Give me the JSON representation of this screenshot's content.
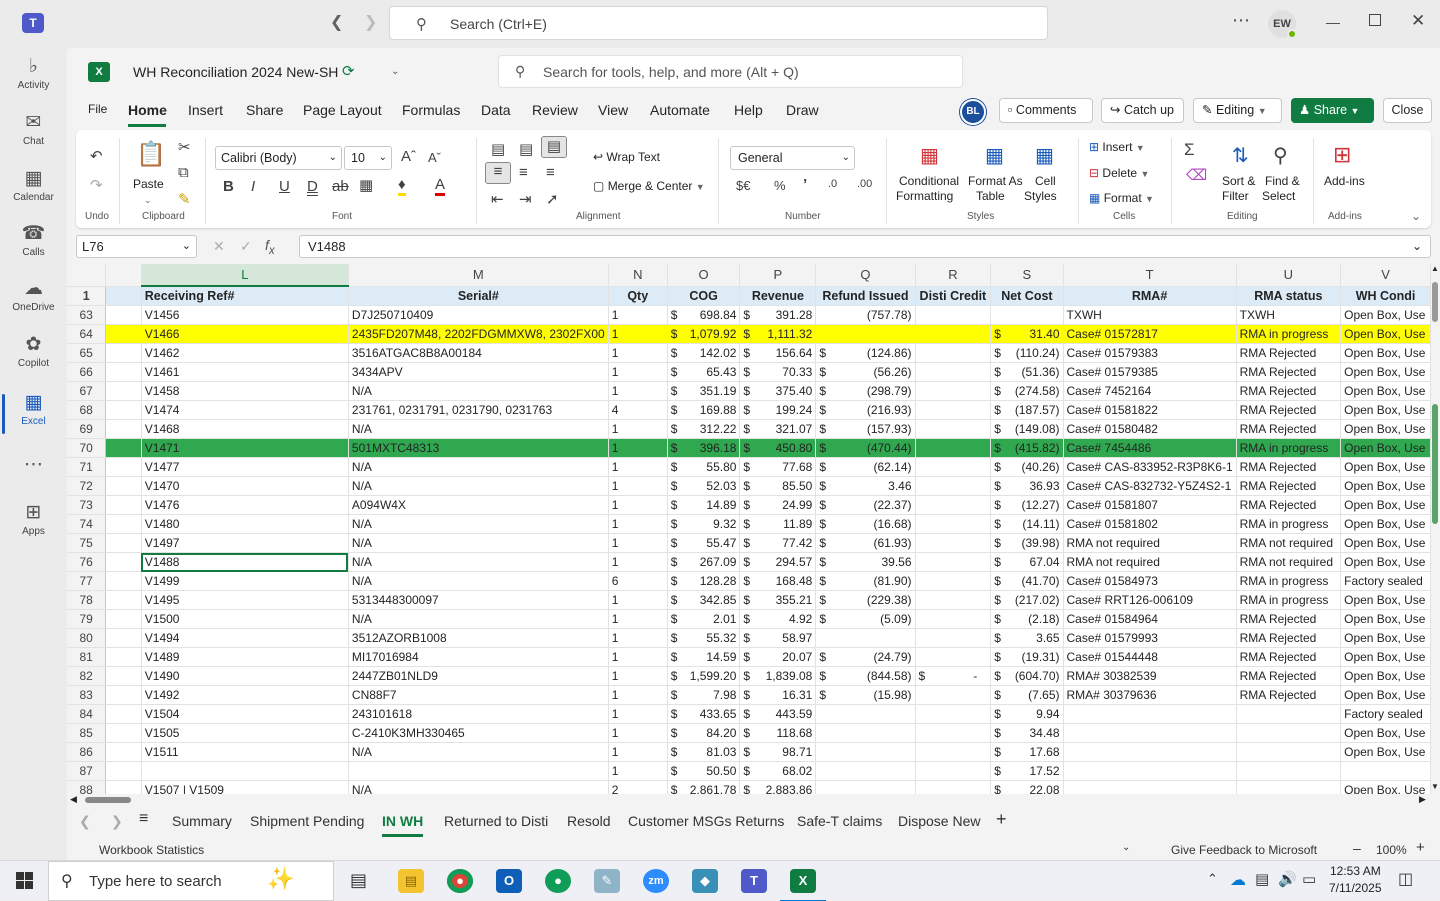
{
  "teams": {
    "search_placeholder": "Search (Ctrl+E)",
    "user_initials": "EW",
    "rail": [
      {
        "label": "Activity",
        "icon": "bell-icon"
      },
      {
        "label": "Chat",
        "icon": "chat-icon"
      },
      {
        "label": "Calendar",
        "icon": "calendar-icon"
      },
      {
        "label": "Calls",
        "icon": "phone-icon"
      },
      {
        "label": "OneDrive",
        "icon": "cloud-icon"
      },
      {
        "label": "Copilot",
        "icon": "copilot-icon"
      },
      {
        "label": "Excel",
        "icon": "excel-icon"
      },
      {
        "label": "Apps",
        "icon": "apps-icon"
      }
    ]
  },
  "excel": {
    "workbook_title": "WH Reconciliation 2024 New-SH",
    "tools_search": "Search for tools, help, and more (Alt + Q)",
    "menu": [
      "File",
      "Home",
      "Insert",
      "Share",
      "Page Layout",
      "Formulas",
      "Data",
      "Review",
      "View",
      "Automate",
      "Help",
      "Draw"
    ],
    "avatar": "BL",
    "comments": "Comments",
    "catch_up": "Catch up",
    "editing": "Editing",
    "share": "Share",
    "close": "Close",
    "ribbon": {
      "undo_group": "Undo",
      "paste": "Paste",
      "clipboard": "Clipboard",
      "font_name": "Calibri (Body)",
      "font_size": "10",
      "font": "Font",
      "wrap_text": "Wrap Text",
      "merge_center": "Merge & Center",
      "alignment": "Alignment",
      "number_format": "General",
      "number": "Number",
      "cond_format_1": "Conditional",
      "cond_format_2": "Formatting",
      "format_table_1": "Format As",
      "format_table_2": "Table",
      "cell_styles_1": "Cell",
      "cell_styles_2": "Styles",
      "styles": "Styles",
      "insert": "Insert",
      "delete": "Delete",
      "format": "Format",
      "cells": "Cells",
      "sort_1": "Sort &",
      "sort_2": "Filter",
      "find_1": "Find &",
      "find_2": "Select",
      "editing_group": "Editing",
      "addins": "Add-ins",
      "addins_group": "Add-ins"
    },
    "name_box": "L76",
    "formula": "V1488",
    "columns": [
      "L",
      "M",
      "N",
      "O",
      "P",
      "Q",
      "R",
      "S",
      "T",
      "U",
      "V"
    ],
    "headers": [
      "Receiving Ref#",
      "Serial#",
      "Qty",
      "COG",
      "Revenue",
      "Refund Issued",
      "Disti Credit",
      "Net Cost",
      "RMA#",
      "RMA status",
      "WH Condi"
    ],
    "rows": [
      {
        "n": "63",
        "ref": "V1456",
        "serial": "D7J250710409",
        "qty": "1",
        "cog": "698.84",
        "rev": "391.28",
        "ref_iss": "(757.78)",
        "disti": "",
        "net": "",
        "rma": "TXWH",
        "status": "TXWH",
        "cond": "Open Box, Use",
        "cog_d": "$",
        "rev_d": "$",
        "ri_d": "",
        "di_d": "",
        "net_d": ""
      },
      {
        "n": "64",
        "ref": "V1466",
        "serial": "2435FD207M48, 2202FDGMMXW8, 2302FX00",
        "qty": "1",
        "cog": "1,079.92",
        "rev": "1,111.32",
        "ref_iss": "",
        "disti": "",
        "net": "31.40",
        "rma": "Case# 01572817",
        "status": "RMA in progress",
        "cond": "Open Box, Use",
        "cog_d": "$",
        "rev_d": "$",
        "ri_d": "",
        "di_d": "",
        "net_d": "$",
        "hl": "yellow"
      },
      {
        "n": "65",
        "ref": "V1462",
        "serial": "3516ATGAC8B8A00184",
        "qty": "1",
        "cog": "142.02",
        "rev": "156.64",
        "ref_iss": "(124.86)",
        "disti": "",
        "net": "(110.24)",
        "rma": "Case# 01579383",
        "status": "RMA Rejected",
        "cond": "Open Box, Use",
        "cog_d": "$",
        "rev_d": "$",
        "ri_d": "$",
        "di_d": "",
        "net_d": "$"
      },
      {
        "n": "66",
        "ref": "V1461",
        "serial": "3434APV",
        "qty": "1",
        "cog": "65.43",
        "rev": "70.33",
        "ref_iss": "(56.26)",
        "disti": "",
        "net": "(51.36)",
        "rma": "Case# 01579385",
        "status": "RMA Rejected",
        "cond": "Open Box, Use",
        "cog_d": "$",
        "rev_d": "$",
        "ri_d": "$",
        "di_d": "",
        "net_d": "$"
      },
      {
        "n": "67",
        "ref": "V1458",
        "serial": "N/A",
        "qty": "1",
        "cog": "351.19",
        "rev": "375.40",
        "ref_iss": "(298.79)",
        "disti": "",
        "net": "(274.58)",
        "rma": "Case# 7452164",
        "status": "RMA Rejected",
        "cond": "Open Box, Use",
        "cog_d": "$",
        "rev_d": "$",
        "ri_d": "$",
        "di_d": "",
        "net_d": "$"
      },
      {
        "n": "68",
        "ref": "V1474",
        "serial": "231761, 0231791, 0231790, 0231763",
        "qty": "4",
        "cog": "169.88",
        "rev": "199.24",
        "ref_iss": "(216.93)",
        "disti": "",
        "net": "(187.57)",
        "rma": "Case# 01581822",
        "status": "RMA Rejected",
        "cond": "Open Box, Use",
        "cog_d": "$",
        "rev_d": "$",
        "ri_d": "$",
        "di_d": "",
        "net_d": "$"
      },
      {
        "n": "69",
        "ref": "V1468",
        "serial": "N/A",
        "qty": "1",
        "cog": "312.22",
        "rev": "321.07",
        "ref_iss": "(157.93)",
        "disti": "",
        "net": "(149.08)",
        "rma": "Case# 01580482",
        "status": "RMA Rejected",
        "cond": "Open Box, Use",
        "cog_d": "$",
        "rev_d": "$",
        "ri_d": "$",
        "di_d": "",
        "net_d": "$"
      },
      {
        "n": "70",
        "ref": "V1471",
        "serial": "501MXTC48313",
        "qty": "1",
        "cog": "396.18",
        "rev": "450.80",
        "ref_iss": "(470.44)",
        "disti": "",
        "net": "(415.82)",
        "rma": "Case# 7454486",
        "status": "RMA in progress",
        "cond": "Open Box, Use",
        "cog_d": "$",
        "rev_d": "$",
        "ri_d": "$",
        "di_d": "",
        "net_d": "$",
        "hl": "green"
      },
      {
        "n": "71",
        "ref": "V1477",
        "serial": "N/A",
        "qty": "1",
        "cog": "55.80",
        "rev": "77.68",
        "ref_iss": "(62.14)",
        "disti": "",
        "net": "(40.26)",
        "rma": "Case# CAS-833952-R3P8K6-1",
        "status": "RMA Rejected",
        "cond": "Open Box, Use",
        "cog_d": "$",
        "rev_d": "$",
        "ri_d": "$",
        "di_d": "",
        "net_d": "$"
      },
      {
        "n": "72",
        "ref": "V1470",
        "serial": "N/A",
        "qty": "1",
        "cog": "52.03",
        "rev": "85.50",
        "ref_iss": "3.46",
        "disti": "",
        "net": "36.93",
        "rma": "Case# CAS-832732-Y5Z4S2-1",
        "status": "RMA Rejected",
        "cond": "Open Box, Use",
        "cog_d": "$",
        "rev_d": "$",
        "ri_d": "$",
        "di_d": "",
        "net_d": "$"
      },
      {
        "n": "73",
        "ref": "V1476",
        "serial": "A094W4X",
        "qty": "1",
        "cog": "14.89",
        "rev": "24.99",
        "ref_iss": "(22.37)",
        "disti": "",
        "net": "(12.27)",
        "rma": "Case# 01581807",
        "status": "RMA Rejected",
        "cond": "Open Box, Use",
        "cog_d": "$",
        "rev_d": "$",
        "ri_d": "$",
        "di_d": "",
        "net_d": "$"
      },
      {
        "n": "74",
        "ref": "V1480",
        "serial": "N/A",
        "qty": "1",
        "cog": "9.32",
        "rev": "11.89",
        "ref_iss": "(16.68)",
        "disti": "",
        "net": "(14.11)",
        "rma": "Case# 01581802",
        "status": "RMA in progress",
        "cond": "Open Box, Use",
        "cog_d": "$",
        "rev_d": "$",
        "ri_d": "$",
        "di_d": "",
        "net_d": "$"
      },
      {
        "n": "75",
        "ref": "V1497",
        "serial": "N/A",
        "qty": "1",
        "cog": "55.47",
        "rev": "77.42",
        "ref_iss": "(61.93)",
        "disti": "",
        "net": "(39.98)",
        "rma": "RMA not required",
        "status": "RMA not required",
        "cond": "Open Box, Use",
        "cog_d": "$",
        "rev_d": "$",
        "ri_d": "$",
        "di_d": "",
        "net_d": "$"
      },
      {
        "n": "76",
        "ref": "V1488",
        "serial": "N/A",
        "qty": "1",
        "cog": "267.09",
        "rev": "294.57",
        "ref_iss": "39.56",
        "disti": "",
        "net": "67.04",
        "rma": "RMA not required",
        "status": "RMA not required",
        "cond": "Open Box, Use",
        "cog_d": "$",
        "rev_d": "$",
        "ri_d": "$",
        "di_d": "",
        "net_d": "$",
        "active": true
      },
      {
        "n": "77",
        "ref": "V1499",
        "serial": "N/A",
        "qty": "6",
        "cog": "128.28",
        "rev": "168.48",
        "ref_iss": "(81.90)",
        "disti": "",
        "net": "(41.70)",
        "rma": "Case# 01584973",
        "status": "RMA in progress",
        "cond": "Factory sealed",
        "cog_d": "$",
        "rev_d": "$",
        "ri_d": "$",
        "di_d": "",
        "net_d": "$"
      },
      {
        "n": "78",
        "ref": "V1495",
        "serial": "5313448300097",
        "qty": "1",
        "cog": "342.85",
        "rev": "355.21",
        "ref_iss": "(229.38)",
        "disti": "",
        "net": "(217.02)",
        "rma": "Case# RRT126-006109",
        "status": "RMA in progress",
        "cond": "Open Box, Use",
        "cog_d": "$",
        "rev_d": "$",
        "ri_d": "$",
        "di_d": "",
        "net_d": "$"
      },
      {
        "n": "79",
        "ref": "V1500",
        "serial": "N/A",
        "qty": "1",
        "cog": "2.01",
        "rev": "4.92",
        "ref_iss": "(5.09)",
        "disti": "",
        "net": "(2.18)",
        "rma": "Case# 01584964",
        "status": "RMA Rejected",
        "cond": "Open Box, Use",
        "cog_d": "$",
        "rev_d": "$",
        "ri_d": "$",
        "di_d": "",
        "net_d": "$"
      },
      {
        "n": "80",
        "ref": "V1494",
        "serial": "3512AZORB1008",
        "qty": "1",
        "cog": "55.32",
        "rev": "58.97",
        "ref_iss": "",
        "disti": "",
        "net": "3.65",
        "rma": "Case# 01579993",
        "status": "RMA Rejected",
        "cond": "Open Box, Use",
        "cog_d": "$",
        "rev_d": "$",
        "ri_d": "",
        "di_d": "",
        "net_d": "$"
      },
      {
        "n": "81",
        "ref": "V1489",
        "serial": "MI17016984",
        "qty": "1",
        "cog": "14.59",
        "rev": "20.07",
        "ref_iss": "(24.79)",
        "disti": "",
        "net": "(19.31)",
        "rma": "Case# 01544448",
        "status": "RMA Rejected",
        "cond": "Open Box, Use",
        "cog_d": "$",
        "rev_d": "$",
        "ri_d": "$",
        "di_d": "",
        "net_d": "$"
      },
      {
        "n": "82",
        "ref": "V1490",
        "serial": "2447ZB01NLD9",
        "qty": "1",
        "cog": "1,599.20",
        "rev": "1,839.08",
        "ref_iss": "(844.58)",
        "disti": "-",
        "net": "(604.70)",
        "rma": "RMA# 30382539",
        "status": "RMA Rejected",
        "cond": "Open Box, Use",
        "cog_d": "$",
        "rev_d": "$",
        "ri_d": "$",
        "di_d": "$",
        "net_d": "$"
      },
      {
        "n": "83",
        "ref": "V1492",
        "serial": "CN88F7",
        "qty": "1",
        "cog": "7.98",
        "rev": "16.31",
        "ref_iss": "(15.98)",
        "disti": "",
        "net": "(7.65)",
        "rma": "RMA# 30379636",
        "status": "RMA Rejected",
        "cond": "Open Box, Use",
        "cog_d": "$",
        "rev_d": "$",
        "ri_d": "$",
        "di_d": "",
        "net_d": "$"
      },
      {
        "n": "84",
        "ref": "V1504",
        "serial": "243101618",
        "qty": "1",
        "cog": "433.65",
        "rev": "443.59",
        "ref_iss": "",
        "disti": "",
        "net": "9.94",
        "rma": "",
        "status": "",
        "cond": "Factory sealed",
        "cog_d": "$",
        "rev_d": "$",
        "ri_d": "",
        "di_d": "",
        "net_d": "$"
      },
      {
        "n": "85",
        "ref": "V1505",
        "serial": "C-2410K3MH330465",
        "qty": "1",
        "cog": "84.20",
        "rev": "118.68",
        "ref_iss": "",
        "disti": "",
        "net": "34.48",
        "rma": "",
        "status": "",
        "cond": "Open Box, Use",
        "cog_d": "$",
        "rev_d": "$",
        "ri_d": "",
        "di_d": "",
        "net_d": "$"
      },
      {
        "n": "86",
        "ref": "V1511",
        "serial": "N/A",
        "qty": "1",
        "cog": "81.03",
        "rev": "98.71",
        "ref_iss": "",
        "disti": "",
        "net": "17.68",
        "rma": "",
        "status": "",
        "cond": "Open Box, Use",
        "cog_d": "$",
        "rev_d": "$",
        "ri_d": "",
        "di_d": "",
        "net_d": "$"
      },
      {
        "n": "87",
        "ref": "",
        "serial": "",
        "qty": "1",
        "cog": "50.50",
        "rev": "68.02",
        "ref_iss": "",
        "disti": "",
        "net": "17.52",
        "rma": "",
        "status": "",
        "cond": "",
        "cog_d": "$",
        "rev_d": "$",
        "ri_d": "",
        "di_d": "",
        "net_d": "$"
      },
      {
        "n": "88",
        "ref": "V1507 | V1509",
        "serial": "N/A",
        "qty": "2",
        "cog": "2,861.78",
        "rev": "2,883.86",
        "ref_iss": "",
        "disti": "",
        "net": "22.08",
        "rma": "",
        "status": "",
        "cond": "Open Box, Use",
        "cog_d": "$",
        "rev_d": "$",
        "ri_d": "",
        "di_d": "",
        "net_d": "$"
      }
    ],
    "sheet_tabs": [
      "Summary",
      "Shipment Pending",
      "IN WH",
      "Returned to Disti",
      "Resold",
      "Customer MSGs Returns",
      "Safe-T claims",
      "Dispose New"
    ],
    "active_sheet": "IN WH",
    "status_left": "Workbook Statistics",
    "feedback": "Give Feedback to Microsoft",
    "zoom": "100%"
  },
  "taskbar": {
    "search_placeholder": "Type here to search",
    "time": "12:53 AM",
    "date": "7/11/2025"
  },
  "colors": {
    "excel_green": "#107c41",
    "yellow_row": "#ffff00",
    "green_row": "#2fa84f",
    "header_fill": "#ddebf7"
  }
}
